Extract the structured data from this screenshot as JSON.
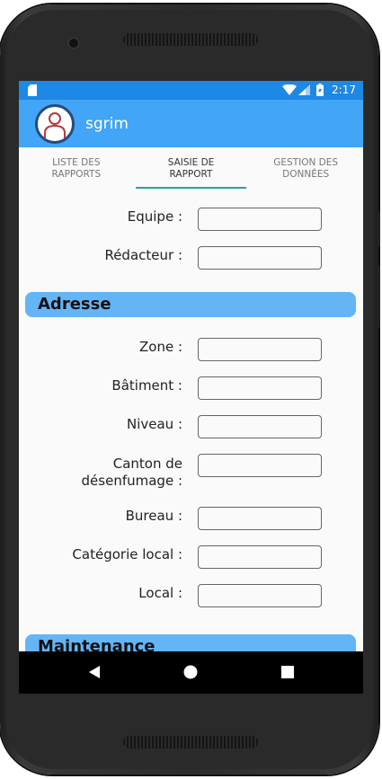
{
  "status": {
    "time": "2:17"
  },
  "app": {
    "title": "sgrim"
  },
  "tabs": [
    {
      "label": "LISTE DES RAPPORTS"
    },
    {
      "label": "SAISIE DE RAPPORT"
    },
    {
      "label": "GESTION DES DONNÉES"
    }
  ],
  "form": {
    "equipe_label": "Equipe :",
    "redacteur_label": "Rédacteur :",
    "section_adresse": "Adresse",
    "zone_label": "Zone :",
    "batiment_label": "Bâtiment :",
    "niveau_label": "Niveau :",
    "canton_label_1": "Canton de",
    "canton_label_2": "désenfumage :",
    "bureau_label": "Bureau :",
    "categorie_label": "Catégorie local :",
    "local_label": "Local :",
    "section_maintenance": "Maintenance"
  },
  "colors": {
    "status_bar": "#1e88e5",
    "app_bar": "#42a5f5",
    "section": "#64b5f6",
    "tab_indicator": "#26a69a"
  }
}
